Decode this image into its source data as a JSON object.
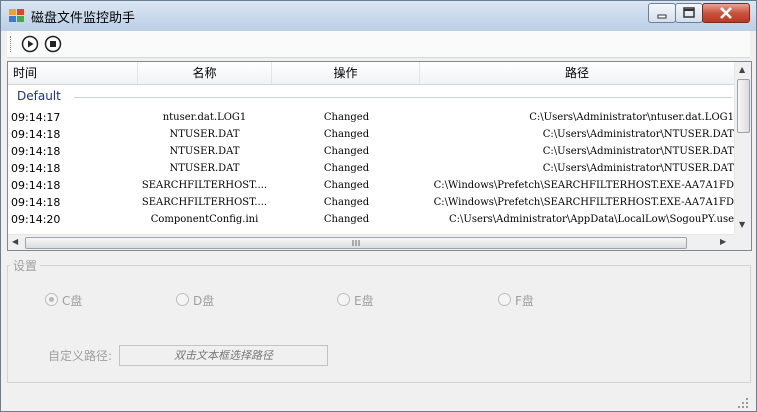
{
  "window": {
    "title": "磁盘文件监控助手"
  },
  "toolbar": {
    "buttons": [
      "start-icon",
      "stop-icon"
    ]
  },
  "list": {
    "columns": [
      "时间",
      "名称",
      "操作",
      "路径"
    ],
    "group": "Default",
    "rows": [
      {
        "time": "09:14:17",
        "name": "ntuser.dat.LOG1",
        "op": "Changed",
        "path": "C:\\Users\\Administrator\\ntuser.dat.LOG1"
      },
      {
        "time": "09:14:18",
        "name": "NTUSER.DAT",
        "op": "Changed",
        "path": "C:\\Users\\Administrator\\NTUSER.DAT"
      },
      {
        "time": "09:14:18",
        "name": "NTUSER.DAT",
        "op": "Changed",
        "path": "C:\\Users\\Administrator\\NTUSER.DAT"
      },
      {
        "time": "09:14:18",
        "name": "NTUSER.DAT",
        "op": "Changed",
        "path": "C:\\Users\\Administrator\\NTUSER.DAT"
      },
      {
        "time": "09:14:18",
        "name": "SEARCHFILTERHOST....",
        "op": "Changed",
        "path": "C:\\Windows\\Prefetch\\SEARCHFILTERHOST.EXE-AA7A1FD"
      },
      {
        "time": "09:14:18",
        "name": "SEARCHFILTERHOST....",
        "op": "Changed",
        "path": "C:\\Windows\\Prefetch\\SEARCHFILTERHOST.EXE-AA7A1FD"
      },
      {
        "time": "09:14:20",
        "name": "ComponentConfig.ini",
        "op": "Changed",
        "path": "C:\\Users\\Administrator\\AppData\\LocalLow\\SogouPY.use"
      }
    ]
  },
  "settings": {
    "title": "设置",
    "drives": [
      {
        "label": "C盘",
        "checked": true
      },
      {
        "label": "D盘",
        "checked": false
      },
      {
        "label": "E盘",
        "checked": false
      },
      {
        "label": "F盘",
        "checked": false
      }
    ],
    "custom_path_label": "自定义路径:",
    "custom_path_placeholder": "双击文本框选择路径"
  }
}
